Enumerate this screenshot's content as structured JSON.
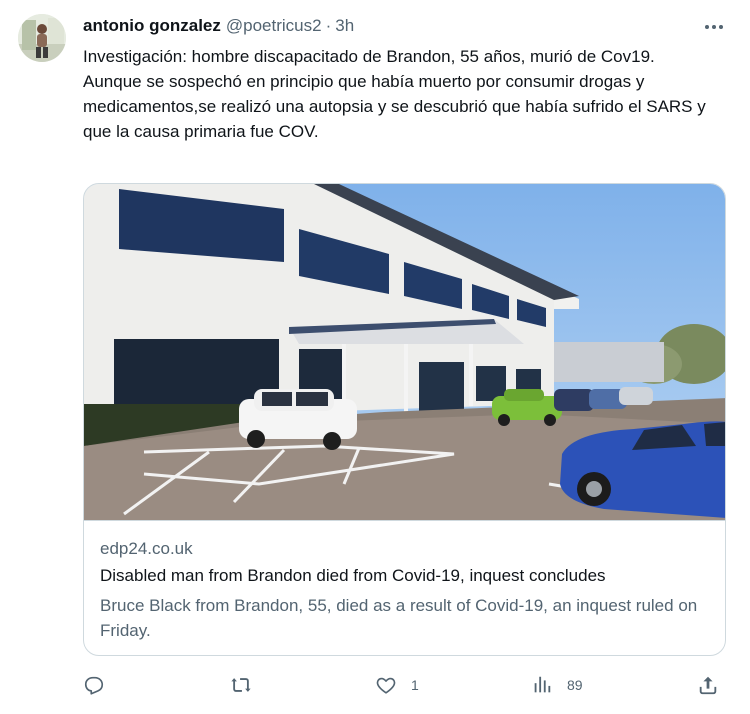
{
  "tweet": {
    "author_name": "antonio gonzalez",
    "handle": "@poetricus2",
    "separator": "·",
    "time": "3h",
    "text": "Investigación: hombre discapacitado de Brandon, 55 años, murió de Cov19.\nAunque se sospechó en principio que había muerto por consumir drogas y medicamentos,se realizó una autopsia y se descubrió que había sufrido el SARS y que la causa primaria fue COV."
  },
  "card": {
    "domain": "edp24.co.uk",
    "title": "Disabled man from Brandon died from Covid-19, inquest concludes",
    "description": "Bruce Black from Brandon, 55, died as a result of Covid-19, an inquest ruled on Friday."
  },
  "actions": {
    "reply_count": "",
    "retweet_count": "",
    "like_count": "1",
    "views_count": "89"
  },
  "icons": {
    "more": "more-horizontal-icon",
    "reply": "reply-icon",
    "retweet": "retweet-icon",
    "like": "heart-icon",
    "views": "views-chart-icon",
    "share": "share-icon"
  },
  "colors": {
    "text_primary": "#0f1419",
    "text_secondary": "#536471",
    "border": "#cfd9de"
  }
}
